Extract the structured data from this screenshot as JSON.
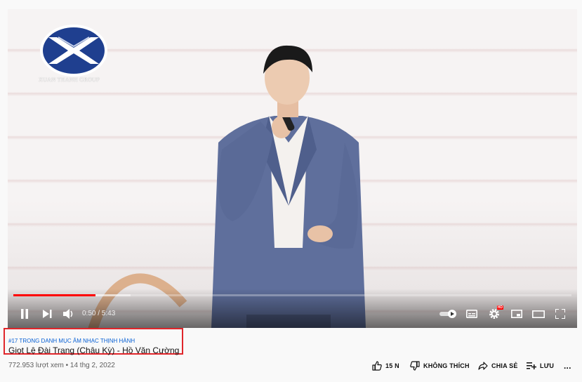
{
  "player": {
    "logo_text": "XUAN THANH GROUP",
    "time": "0:50 / 5:43",
    "progress_played": 0.147,
    "progress_buffered": 0.21,
    "settings_badge": "HD"
  },
  "video": {
    "hashtag": "#17 TRONG DANH MỤC ÂM NHẠC THỊNH HÀNH",
    "title": "Giọt Lệ Đài Trang (Châu Kỳ) - Hồ Văn Cường",
    "views": "772.953 lượt xem • 14 thg 2, 2022"
  },
  "actions": {
    "like": "15 N",
    "dislike": "KHÔNG THÍCH",
    "share": "CHIA SẺ",
    "save": "LƯU",
    "more": "..."
  },
  "colors": {
    "progress": "#ff0000",
    "hashtag": "#065fd4",
    "highlight_box": "#e0262b"
  }
}
